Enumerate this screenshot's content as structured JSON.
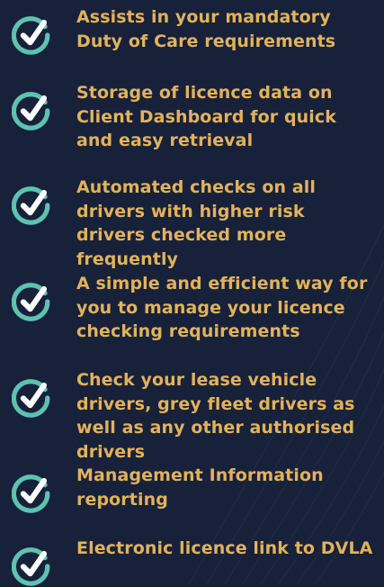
{
  "colors": {
    "background": "#17213a",
    "text": "#e2b25b",
    "check_ring": "#5ec2b0",
    "check_mark": "#ffffff"
  },
  "benefits": [
    {
      "icon": "check-circle-icon",
      "text": "Assists in your mandatory Duty of Care requirements"
    },
    {
      "icon": "check-circle-icon",
      "text": "Storage of licence data on Client Dashboard for quick and easy retrieval"
    },
    {
      "icon": "check-circle-icon",
      "text": "Automated checks on all drivers with higher risk drivers checked more frequently"
    },
    {
      "icon": "check-circle-icon",
      "text": "A simple and efficient way for you to manage your licence checking requirements"
    },
    {
      "icon": "check-circle-icon",
      "text": "Check your lease vehicle drivers, grey fleet drivers as well as any other authorised drivers"
    },
    {
      "icon": "check-circle-icon",
      "text": "Management Information reporting"
    },
    {
      "icon": "check-circle-icon",
      "text": "Electronic licence link to DVLA"
    }
  ]
}
